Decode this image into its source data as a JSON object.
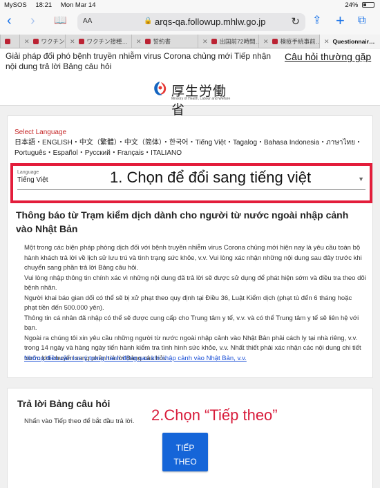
{
  "status_bar": {
    "carrier": "MySOS",
    "time": "18:21",
    "date": "Mon Mar 14",
    "battery": "24%"
  },
  "browser": {
    "text_size_button": "AA",
    "url": "arqs-qa.followup.mhlw.go.jp",
    "tabs": [
      {
        "label": "",
        "favicon": true
      },
      {
        "label": "ワクチン接…",
        "favicon": true
      },
      {
        "label": "ワクチン接種…",
        "favicon": true
      },
      {
        "label": "誓約書",
        "favicon": true
      },
      {
        "label": "出国前72時間…",
        "favicon": true
      },
      {
        "label": "検疫手続事前…",
        "favicon": true
      },
      {
        "label": "Questionnair…",
        "active": true
      }
    ]
  },
  "header": {
    "notice": "Giải pháp đối phó bệnh truyền nhiễm virus Corona chủng mới Tiếp nhận nội dung trả lời Bảng câu hỏi",
    "faq_link": "Câu hỏi thường gặp",
    "logo_ja": "厚生労働省",
    "logo_en": "Ministry of Health, Labour and Welfare"
  },
  "language": {
    "title": "Select Language",
    "options_text": "日本語・ENGLISH・中文（繁體）・中文（简体）・한국어・Tiếng Việt・Tagalog・Bahasa Indonesia・ภาษาไทย・Português・Español・Русский・Français・ITALIANO",
    "field_label": "Language",
    "selected": "Tiếng Việt",
    "annotation": "1.  Chọn để đổi sang tiếng việt"
  },
  "notice_card": {
    "heading": "Thông báo từ Trạm kiểm dịch dành cho người từ nước ngoài nhập cảnh vào Nhật Bản",
    "paragraphs": [
      "Một trong các biện pháp phòng dịch đối với bệnh truyền nhiễm virus Corona chủng mới hiện nay là yêu cầu toàn bộ hành khách trả lời về lịch sử lưu trú và tình trạng sức khỏe, v.v. Vui lòng xác nhận những nội dung sau đây trước khi chuyển sang phần trả lời Bảng câu hỏi.",
      "Vui lòng nhập thông tin chính xác vì những nội dung đã trả lời sẽ được sử dụng để phát hiện sớm và điều tra theo dõi bệnh nhân.",
      "Người khai báo gian dối có thể sẽ bị xử phạt theo quy định tại Điều 36, Luật Kiểm dịch (phạt tù đến 6 tháng hoặc phạt tiền đến 500.000 yên).",
      "Thông tin cá nhân đã nhập có thể sẽ được cung cấp cho Trung tâm y tế, v.v. và có thể Trung tâm y tế sẽ liên hệ với bạn.",
      "Ngoài ra chúng tôi xin yêu cầu những người từ nước ngoài nhập cảnh vào Nhật Bản phải cách ly tại nhà riêng, v.v. trong 14 ngày và hàng ngày tiến hành kiểm tra tình hình sức khỏe, v.v. Nhất thiết phải xác nhận các nội dung chi tiết trước khi chuyển sang phần trả lời Bảng câu hỏi."
    ],
    "link": "Những điều cần lưu ý trong hành động sau khi nhập cảnh vào Nhật Bản, v.v."
  },
  "answer_card": {
    "title": "Trả lời Bảng câu hỏi",
    "description": "Nhấn vào Tiếp theo để bắt đầu trả lời.",
    "annotation": "2.Chọn “Tiếp theo”",
    "next_button": "TIẾP\nTHEO"
  }
}
